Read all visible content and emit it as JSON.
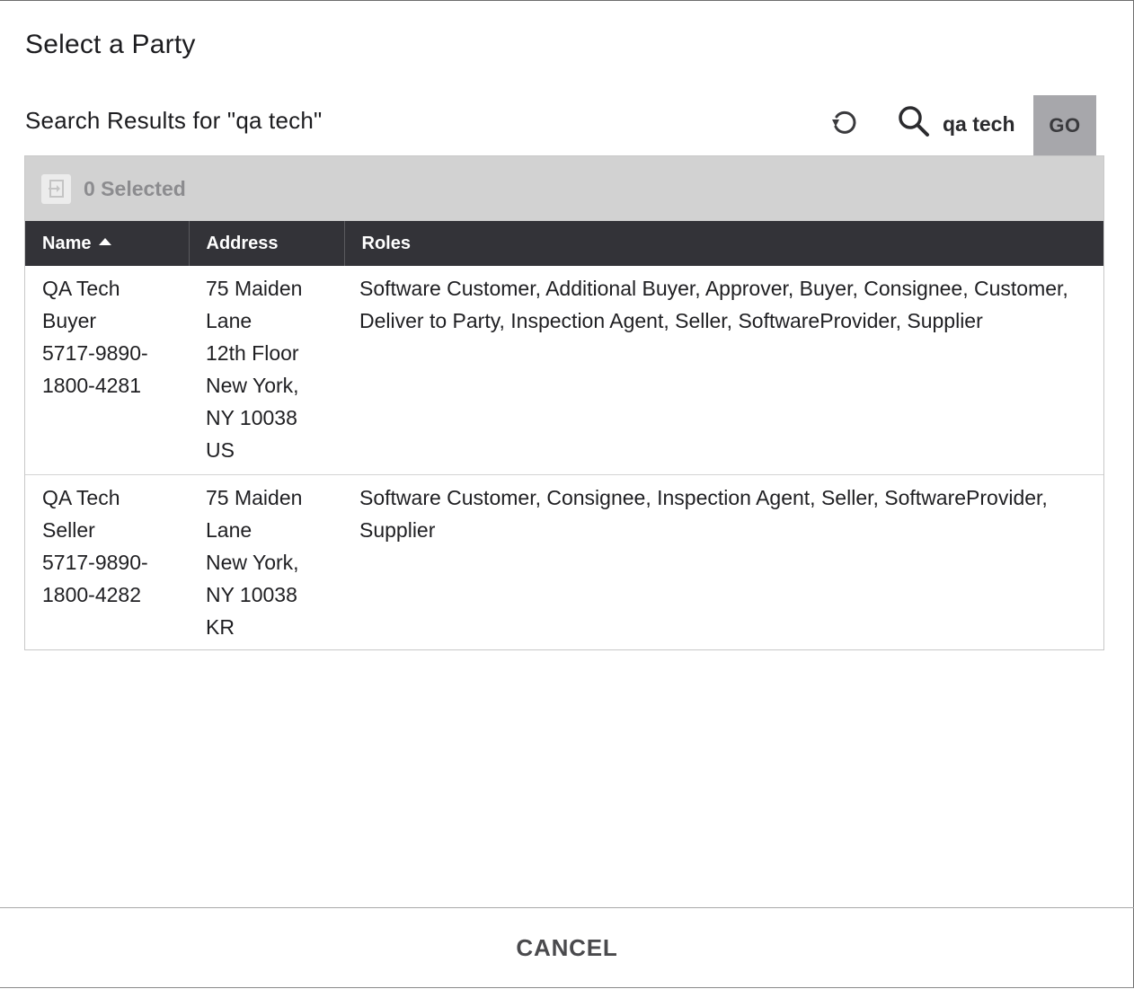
{
  "dialog": {
    "title": "Select a Party"
  },
  "search": {
    "results_title": "Search Results for \"qa tech\"",
    "value": "qa tech",
    "go_label": "GO",
    "reset_icon": "reset-icon",
    "search_icon": "search-icon"
  },
  "selection": {
    "icon": "move-to-icon",
    "label": "0 Selected"
  },
  "table": {
    "columns": [
      {
        "label": "Name",
        "sorted": "ascending"
      },
      {
        "label": "Address"
      },
      {
        "label": "Roles"
      }
    ],
    "rows": [
      {
        "name": [
          "QA Tech",
          "Buyer",
          "5717-9890-",
          "1800-4281"
        ],
        "address": [
          "75 Maiden",
          "Lane",
          "12th Floor",
          "New York,",
          "NY 10038",
          "US"
        ],
        "roles": "Software Customer, Additional Buyer, Approver, Buyer, Consignee, Customer, Deliver to Party, Inspection Agent, Seller, SoftwareProvider, Supplier"
      },
      {
        "name": [
          "QA Tech",
          "Seller",
          "5717-9890-",
          "1800-4282"
        ],
        "address": [
          "75 Maiden",
          "Lane",
          "New York,",
          "NY 10038",
          "KR"
        ],
        "roles": "Software Customer, Consignee, Inspection Agent, Seller, SoftwareProvider, Supplier"
      }
    ]
  },
  "footer": {
    "cancel_label": "CANCEL"
  }
}
